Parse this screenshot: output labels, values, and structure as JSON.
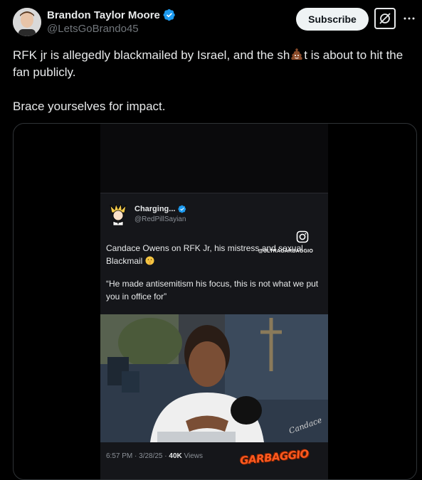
{
  "author": {
    "name": "Brandon Taylor Moore",
    "handle": "@LetsGoBrando45",
    "verified": true
  },
  "actions": {
    "subscribe_label": "Subscribe",
    "grok_icon": "grok-icon",
    "more_icon": "more-icon"
  },
  "post": {
    "text_part1": "RFK jr is allegedly blackmailed by Israel, and the sh",
    "emoji": "poop-emoji",
    "text_part2": "t is about to hit the fan publicly.",
    "text_line2": "Brace yourselves for impact."
  },
  "media": {
    "inner_tweet": {
      "name": "Charging...",
      "handle": "@RedPillSayian",
      "verified": true,
      "text": "Candace Owens on RFK Jr, his mistress and sexual Blackmail",
      "quote": "“He made antisemitism his focus, this is not what we put you in office for”",
      "time": "6:57 PM · 3/28/25 · ",
      "views_count": "40K",
      "views_label": " Views"
    },
    "instagram_watermark": "@ULTRAGARBAGGIO",
    "signature": "Candace",
    "brand_watermark": "GARBAGGIO"
  },
  "colors": {
    "background": "#000000",
    "text": "#e7e9ea",
    "secondary": "#71767b",
    "verified": "#1d9bf0",
    "subscribe_bg": "#eff3f4"
  }
}
